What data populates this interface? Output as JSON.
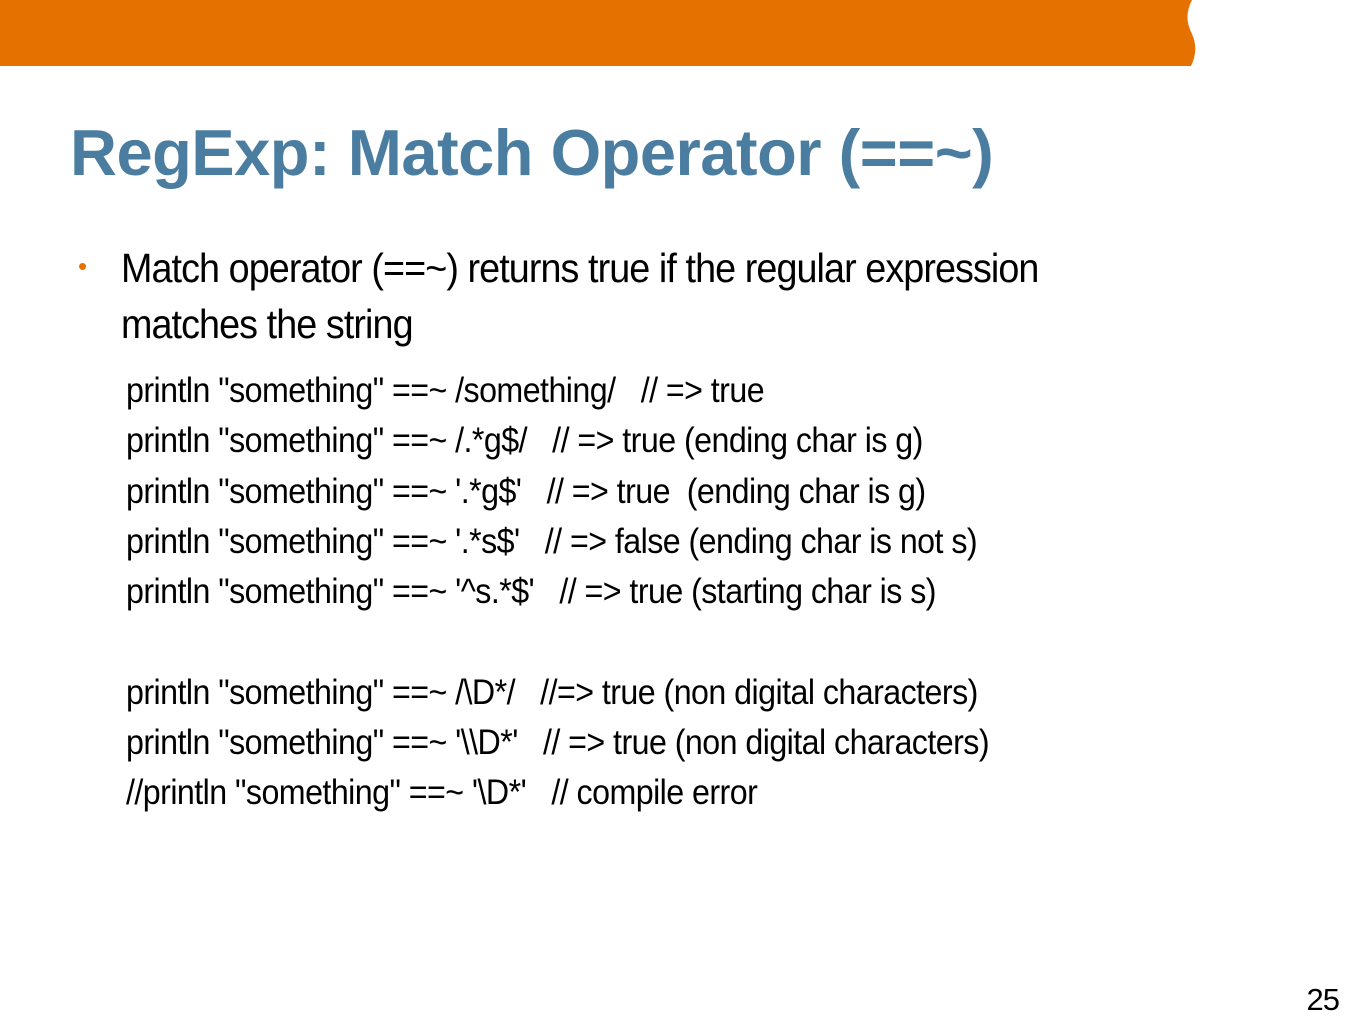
{
  "colors": {
    "header_band": "#E57200",
    "title": "#4A7DA0",
    "bullet_marker": "#E57200",
    "text": "#000000"
  },
  "slide": {
    "title": "RegExp: Match Operator (==~)",
    "bullet": {
      "marker": "•",
      "text": "Match operator (==~) returns true if the regular expression matches the string"
    },
    "code_lines": [
      "println \"something\" ==~ /something/   // => true",
      "println \"something\" ==~ /.*g$/   // => true (ending char is g)",
      "println \"something\" ==~ '.*g$'   // => true  (ending char is g)",
      "println \"something\" ==~ '.*s$'   // => false (ending char is not s)",
      "println \"something\" ==~ '^s.*$'   // => true (starting char is s)",
      "",
      "println \"something\" ==~ /\\D*/   //=> true (non digital characters)",
      "println \"something\" ==~ '\\\\D*'   // => true (non digital characters)",
      "//println \"something\" ==~ '\\D*'   // compile error"
    ],
    "page_number": "25"
  }
}
